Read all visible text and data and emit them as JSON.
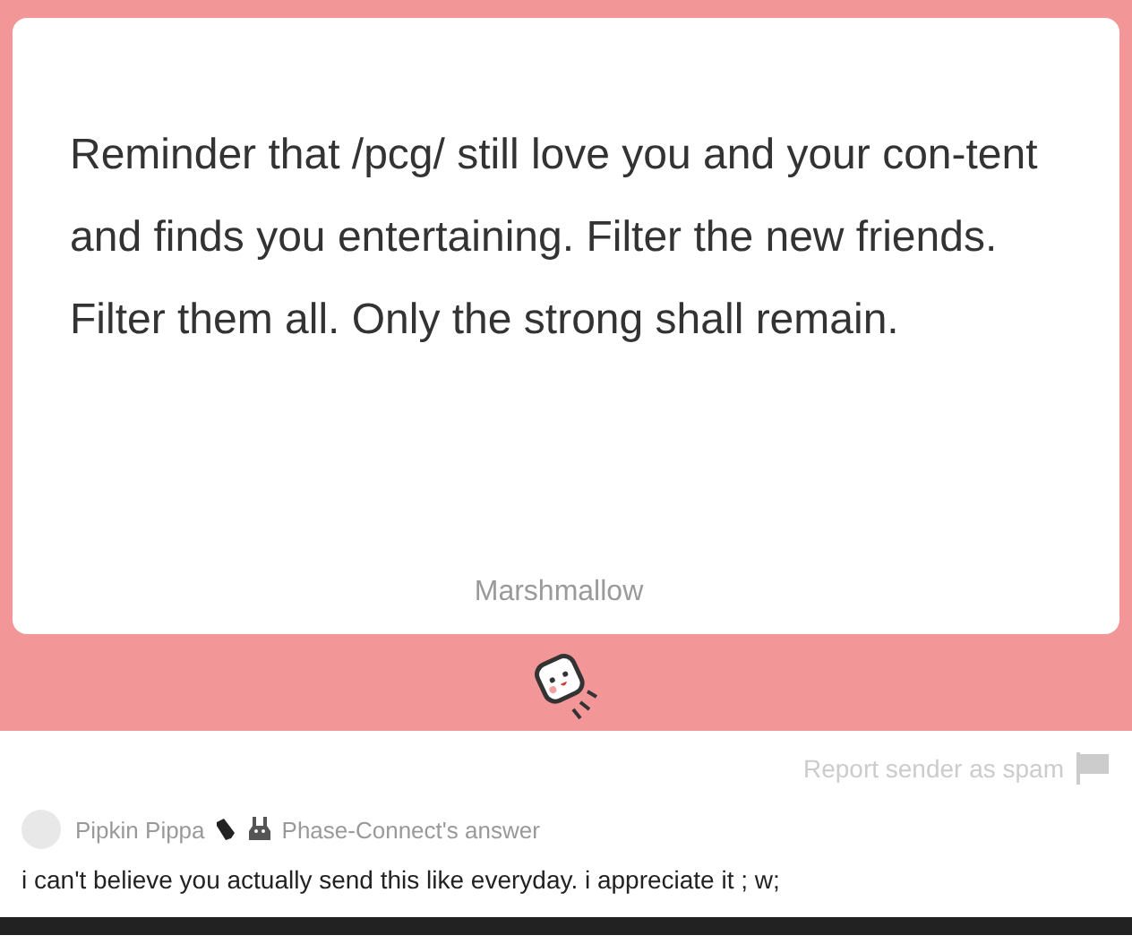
{
  "message": {
    "text": "Reminder that /pcg/ still love you and your con-tent and finds you entertaining. Filter the new friends. Filter them all. Only the strong shall remain.",
    "brand": "Marshmallow"
  },
  "report": {
    "label": "Report sender as spam"
  },
  "answer": {
    "author": "Pipkin Pippa",
    "group": "Phase-Connect's answer",
    "text": "i can't believe you actually send this like everyday. i appreciate it ; w;"
  }
}
